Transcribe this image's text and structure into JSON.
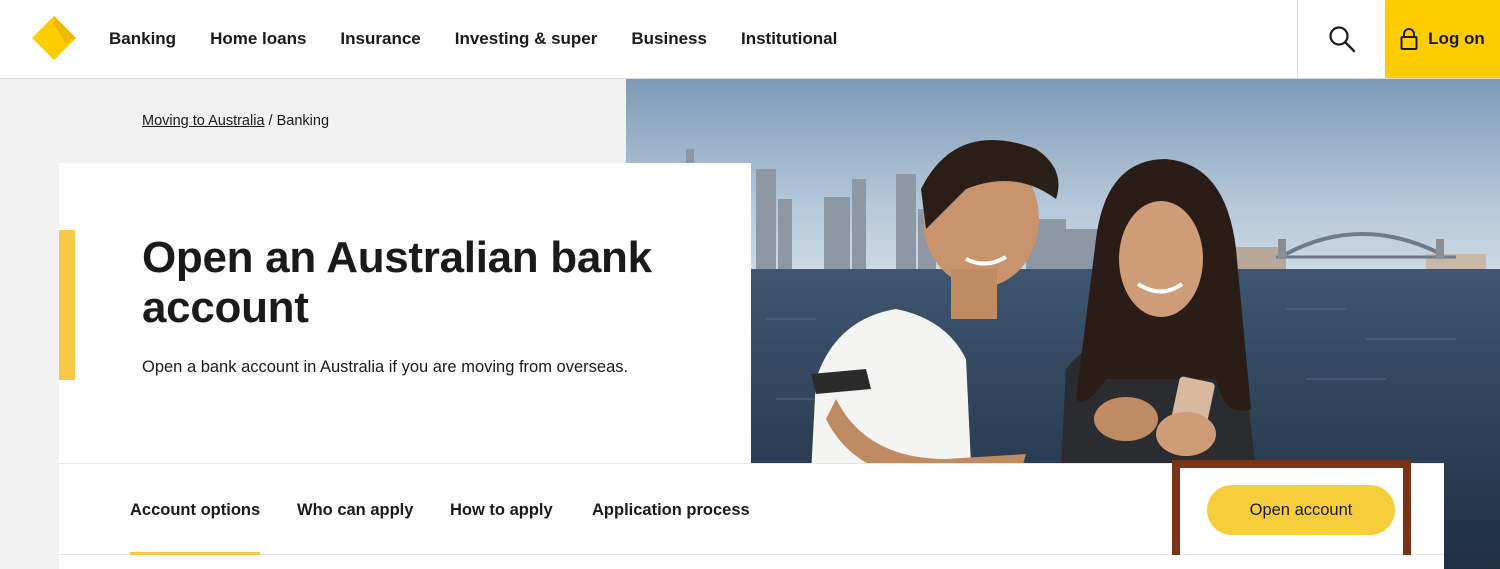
{
  "header": {
    "nav": [
      "Banking",
      "Home loans",
      "Insurance",
      "Investing & super",
      "Business",
      "Institutional"
    ],
    "logon_label": "Log on"
  },
  "icons": {
    "logo": "commbank-diamond-logo",
    "search": "search-icon",
    "logon": "lock-icon"
  },
  "colors": {
    "brand_yellow": "#ffcc00",
    "accent_yellow": "#f6c944",
    "highlight_border": "#7a3316"
  },
  "breadcrumb": {
    "link": "Moving to Australia",
    "separator": "/",
    "current": "Banking"
  },
  "hero": {
    "title": "Open an Australian bank account",
    "subtitle": "Open a bank account in Australia if you are moving from overseas."
  },
  "tabs": {
    "items": [
      "Account options",
      "Who can apply",
      "How to apply",
      "Application process"
    ],
    "active": "Account options"
  },
  "cta": {
    "open_account_label": "Open account"
  }
}
